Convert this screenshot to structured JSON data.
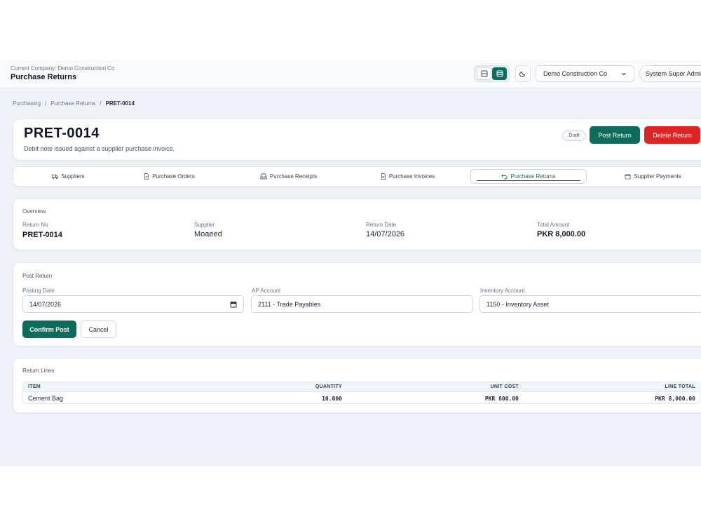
{
  "header": {
    "company_line": "Current Company: Demo Construction Co",
    "page_title": "Purchase Returns",
    "company_select": "Demo Construction Co",
    "user": "System Super Admin"
  },
  "breadcrumb": {
    "items": [
      "Purchasing",
      "Purchase Returns"
    ],
    "current": "PRET-0014"
  },
  "document": {
    "title": "PRET-0014",
    "subtitle": "Debit note issued against a supplier purchase invoice.",
    "status": "Draft",
    "post_label": "Post Return",
    "delete_label": "Delete Return"
  },
  "tabs": [
    {
      "label": "Suppliers",
      "icon": "truck-icon"
    },
    {
      "label": "Purchase Orders",
      "icon": "document-icon"
    },
    {
      "label": "Purchase Receipts",
      "icon": "inbox-icon"
    },
    {
      "label": "Purchase Invoices",
      "icon": "document-icon"
    },
    {
      "label": "Purchase Returns",
      "icon": "undo-icon"
    },
    {
      "label": "Supplier Payments",
      "icon": "wallet-icon"
    }
  ],
  "overview": {
    "section": "Overview",
    "fields": [
      {
        "label": "Return No",
        "value": "PRET-0014"
      },
      {
        "label": "Supplier",
        "value": "Moaeed"
      },
      {
        "label": "Return Date",
        "value": "14/07/2026"
      },
      {
        "label": "Total Amount",
        "value": "PKR 8,000.00"
      }
    ]
  },
  "post_return": {
    "section": "Post Return",
    "posting_date_label": "Posting Date",
    "posting_date": "14/07/2026",
    "ap_account_label": "AP Account",
    "ap_account": "2111 - Trade Payables",
    "inventory_account_label": "Inventory Account",
    "inventory_account": "1150 - Inventory Asset",
    "confirm_label": "Confirm Post",
    "cancel_label": "Cancel"
  },
  "lines": {
    "section": "Return Lines",
    "columns": [
      "ITEM",
      "QUANTITY",
      "UNIT COST",
      "LINE TOTAL"
    ],
    "rows": [
      {
        "item": "Cement Bag",
        "quantity": "10.000",
        "unit_cost": "PKR 800.00",
        "line_total": "PKR 8,000.00"
      }
    ]
  },
  "colors": {
    "primary": "#0f6b5c",
    "danger": "#dc2626",
    "app_background": "#eef2f7"
  }
}
